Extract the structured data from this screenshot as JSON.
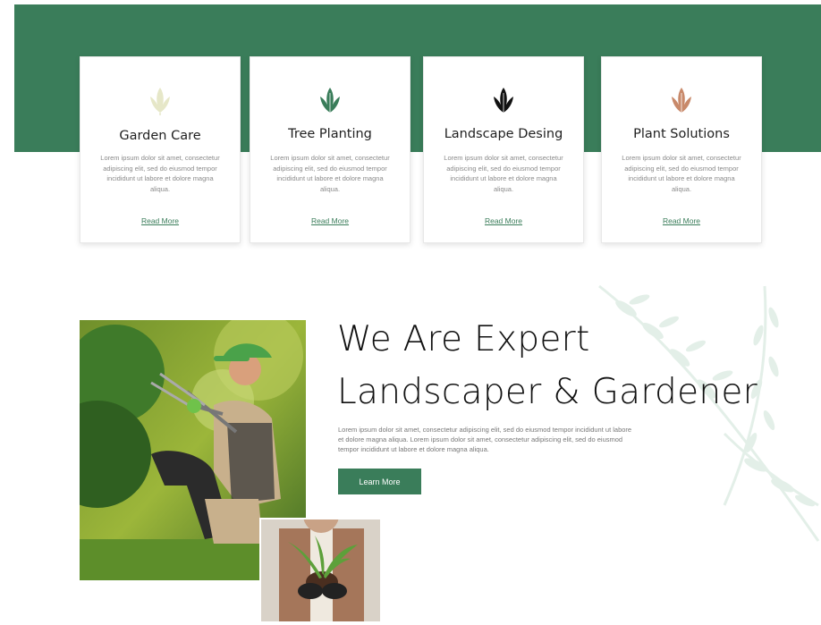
{
  "colors": {
    "brand_green": "#3a7d5a",
    "leaf_pale": "#e6e7c8",
    "leaf_green": "#3a7d5a",
    "leaf_black": "#111111",
    "leaf_orange": "#c8896a"
  },
  "services": [
    {
      "title": "Garden Care",
      "icon": "leaf-pale-icon",
      "description": "Lorem ipsum dolor sit amet, consectetur adipiscing elit, sed do eiusmod tempor incididunt ut labore et dolore magna aliqua.",
      "link": "Read More"
    },
    {
      "title": "Tree Planting",
      "icon": "leaf-green-icon",
      "description": "Lorem ipsum dolor sit amet, consectetur adipiscing elit, sed do eiusmod tempor incididunt ut labore et dolore magna aliqua.",
      "link": "Read More"
    },
    {
      "title": "Landscape Desing",
      "icon": "leaf-black-icon",
      "description": "Lorem ipsum dolor sit amet, consectetur adipiscing elit, sed do eiusmod tempor incididunt ut labore et dolore magna aliqua.",
      "link": "Read More"
    },
    {
      "title": "Plant Solutions",
      "icon": "leaf-orange-icon",
      "description": "Lorem ipsum dolor sit amet, consectetur adipiscing elit, sed do eiusmod tempor incididunt ut labore et dolore magna aliqua.",
      "link": "Read More"
    }
  ],
  "about": {
    "heading_line1": "We Are Expert",
    "heading_line2": "Landscaper & Gardener",
    "paragraph": "Lorem ipsum dolor sit amet, consectetur adipiscing elit, sed do eiusmod tempor incididunt ut labore et dolore magna aliqua. Lorem ipsum dolor sit amet, consectetur adipiscing elit, sed do eiusmod tempor incididunt ut labore et dolore magna aliqua.",
    "button": "Learn More"
  }
}
